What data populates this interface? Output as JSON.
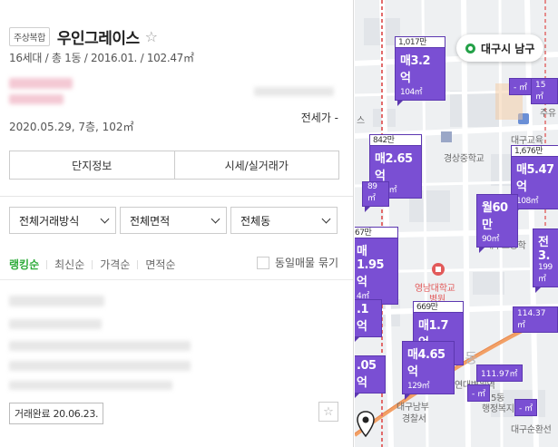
{
  "complex": {
    "type_tag": "주상복합",
    "name": "우인그레이스",
    "summary": "16세대 / 총 1동 / 2016.01. / 102.47㎡",
    "recent_trade": "2020.05.29, 7층, 102㎡",
    "jeonse_label": "전세가 -"
  },
  "tabs": {
    "info": "단지정보",
    "price": "시세/실거래가"
  },
  "filters": {
    "trade_type": "전체거래방식",
    "area": "전체면적",
    "building": "전체동"
  },
  "sort": {
    "items": [
      "랭킹순",
      "최신순",
      "가격순",
      "면적순"
    ],
    "active": "랭킹순",
    "same_label": "동일매물 묶기"
  },
  "listing": {
    "deal_badge": "거래완료 20.06.23."
  },
  "map": {
    "region": "대구시  남구",
    "pins": [
      {
        "top": "1,017만",
        "price": "매3.2억",
        "area": "104㎡"
      },
      {
        "top": "842만",
        "price": "매2.65억",
        "area": "104㎡"
      },
      {
        "top": "1,676만",
        "price": "매5.47억",
        "area": "108㎡"
      },
      {
        "top": "",
        "price": "월60만",
        "area": "90㎡"
      },
      {
        "top": "67만",
        "price": "매1.95억",
        "area": "4㎡"
      },
      {
        "top": "669만",
        "price": "매1.7억",
        "area": "84㎡"
      },
      {
        "top": "",
        "price": "매4.65억",
        "area": "129㎡"
      },
      {
        "top": "",
        "price": ".1억",
        "area": ""
      },
      {
        "top": "",
        "price": ".05억",
        "area": ""
      },
      {
        "top": "",
        "price": "전3.",
        "area": "199㎡"
      },
      {
        "top": "",
        "price": "",
        "area": "89㎡"
      }
    ],
    "minis": [
      "- ㎡",
      "15㎡",
      "114.37㎡",
      "111.97㎡",
      "- ㎡",
      "- ㎡"
    ],
    "labels": [
      "경상중학교",
      "대구교육",
      "대구고등학",
      "영남대학교",
      "병원",
      "대구남부",
      "경찰서",
      "대구순환선",
      "GS",
      "주유",
      "스",
      "연대병원역",
      "5동",
      "행정복지센",
      "5동"
    ]
  }
}
